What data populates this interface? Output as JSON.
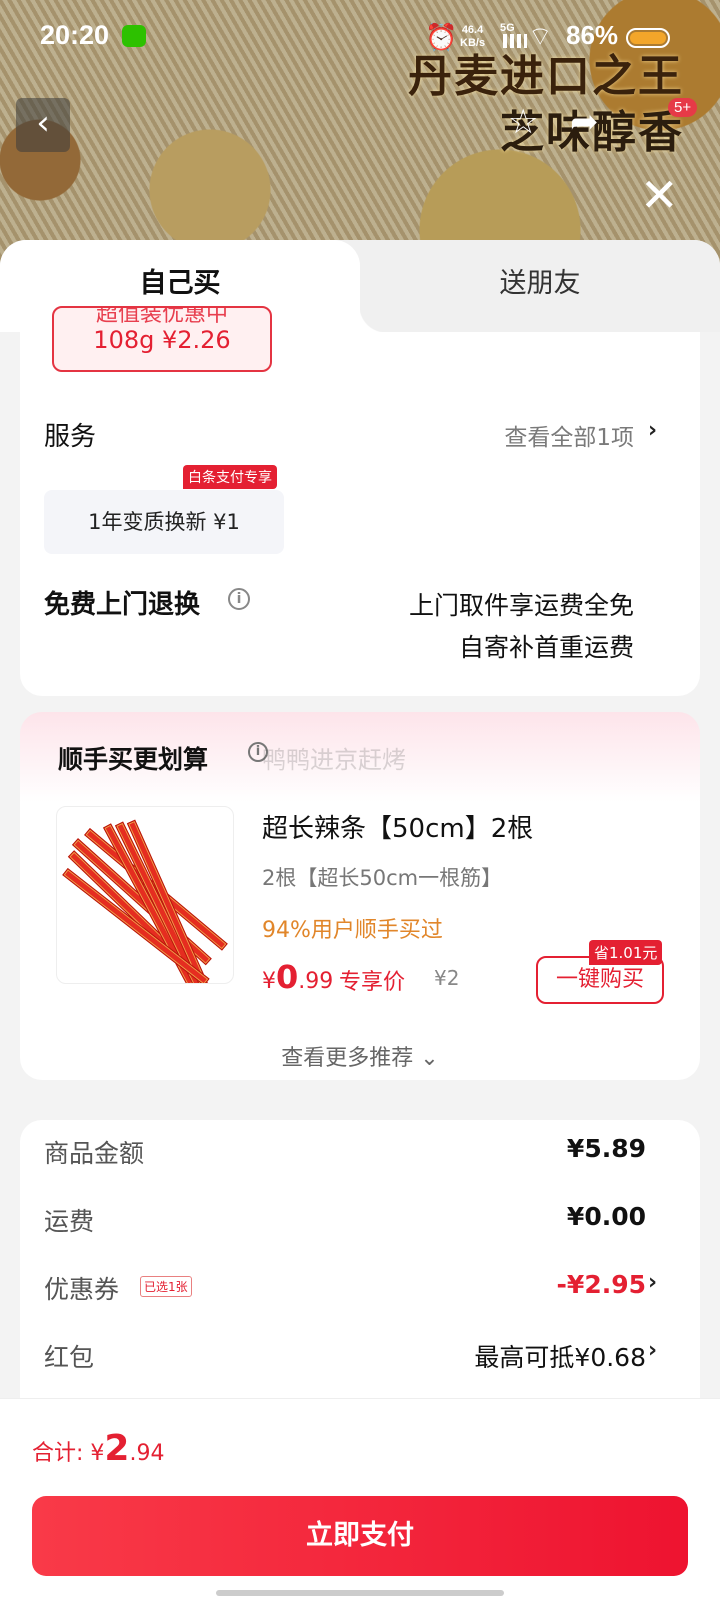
{
  "status_bar": {
    "time": "20:20",
    "net_speed": "46.4",
    "net_unit": "KB/s",
    "network": "5G",
    "battery": "86%"
  },
  "hero": {
    "line1": "丹麦进口之王",
    "line2": "芝味醇香",
    "badge": "5+"
  },
  "tabs": [
    {
      "label": "自己买",
      "active": true
    },
    {
      "label": "送朋友",
      "active": false
    }
  ],
  "selected_sku": {
    "cut_text": "超值装优惠中",
    "label": "108g ¥2.26"
  },
  "service": {
    "title": "服务",
    "view_all": "查看全部1项",
    "item_label": "1年变质换新 ¥1",
    "item_tag": "白条支付专享"
  },
  "return_service": {
    "title": "免费上门退换",
    "line1": "上门取件享运费全免",
    "line2": "自寄补首重运费"
  },
  "recommend": {
    "title": "顺手买更划算",
    "watermark": "鸭鸭进京赶烤",
    "product_name": "超长辣条【50cm】2根",
    "product_sku": "2根【超长50cm一根筋】",
    "popularity": "94%用户顺手买过",
    "price_symbol": "¥",
    "price_int": "0",
    "price_dec": ".99",
    "exclusive": "专享价",
    "original_price": "¥2",
    "buy_label": "一键购买",
    "save_tag": "省1.01元",
    "more": "查看更多推荐 ⌄"
  },
  "amounts": {
    "goods_label": "商品金额",
    "goods_value": "¥5.89",
    "shipping_label": "运费",
    "shipping_value": "¥0.00",
    "coupon_label": "优惠券",
    "coupon_tag": "已选1张",
    "coupon_value": "-¥2.95",
    "redpacket_label": "红包",
    "redpacket_value": "最高可抵¥0.68"
  },
  "footer": {
    "total_label": "合计: ",
    "total_symbol": "¥",
    "total_int": "2",
    "total_dec": ".94",
    "pay_label": "立即支付"
  },
  "colors": {
    "accent_red": "#e42032",
    "pay_button": "#f93a48",
    "popularity_orange": "#e1862a"
  }
}
